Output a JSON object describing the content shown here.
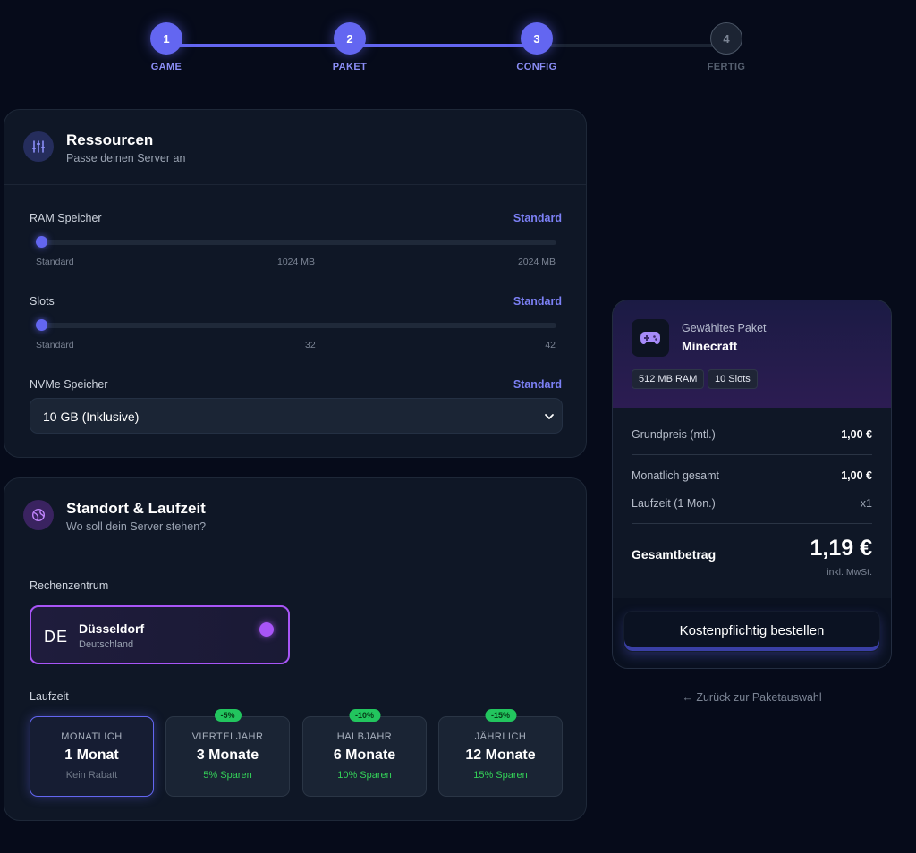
{
  "stepper": {
    "steps": [
      {
        "number": "1",
        "label": "GAME"
      },
      {
        "number": "2",
        "label": "PAKET"
      },
      {
        "number": "3",
        "label": "CONFIG"
      },
      {
        "number": "4",
        "label": "FERTIG"
      }
    ],
    "active_color": "#6366f1"
  },
  "resources": {
    "title": "Ressourcen",
    "subtitle": "Passe deinen Server an",
    "icon": "sliders-icon",
    "ram": {
      "label": "RAM Speicher",
      "value_label": "Standard",
      "ticks": [
        "Standard",
        "1024 MB",
        "2024 MB"
      ],
      "position": 0
    },
    "slots": {
      "label": "Slots",
      "value_label": "Standard",
      "ticks": [
        "Standard",
        "32",
        "42"
      ],
      "position": 0
    },
    "nvme": {
      "label": "NVMe Speicher",
      "value_label": "Standard",
      "selected": "10 GB (Inklusive)"
    }
  },
  "location": {
    "title": "Standort & Laufzeit",
    "subtitle": "Wo soll dein Server stehen?",
    "icon": "globe-icon",
    "datacenter_label": "Rechenzentrum",
    "datacenter": {
      "code": "DE",
      "city": "Düsseldorf",
      "country": "Deutschland"
    },
    "duration_label": "Laufzeit",
    "durations": [
      {
        "name": "MONATLICH",
        "value": "1 Monat",
        "save": "Kein Rabatt",
        "badge": ""
      },
      {
        "name": "VIERTELJAHR",
        "value": "3 Monate",
        "save": "5% Sparen",
        "badge": "-5%"
      },
      {
        "name": "HALBJAHR",
        "value": "6 Monate",
        "save": "10% Sparen",
        "badge": "-10%"
      },
      {
        "name": "JÄHRLICH",
        "value": "12 Monate",
        "save": "15% Sparen",
        "badge": "-15%"
      }
    ]
  },
  "summary": {
    "package_label": "Gewähltes Paket",
    "package_name": "Minecraft",
    "icon": "gamepad-icon",
    "chips": [
      "512 MB RAM",
      "10 Slots"
    ],
    "base_price_label": "Grundpreis (mtl.)",
    "base_price": "1,00 €",
    "monthly_total_label": "Monatlich gesamt",
    "monthly_total": "1,00 €",
    "term_label": "Laufzeit (1 Mon.)",
    "term_value": "x1",
    "total_label": "Gesamtbetrag",
    "total": "1,19 €",
    "tax_note": "inkl. MwSt.",
    "order_button": "Kostenpflichtig bestellen",
    "back_link": "← Zurück zur Paketauswahl"
  }
}
